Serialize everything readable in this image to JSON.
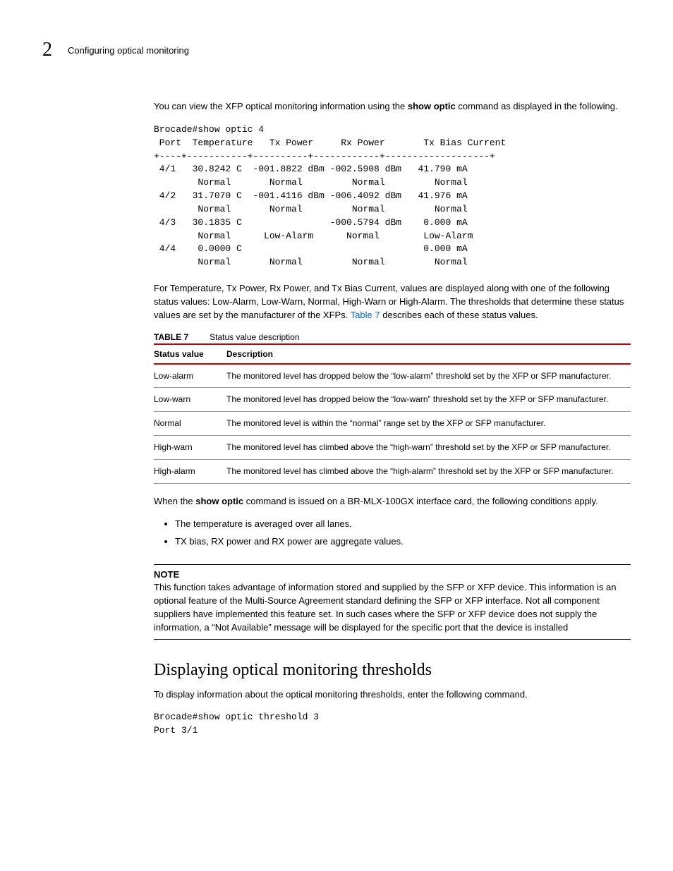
{
  "chapter": {
    "number": "2",
    "title": "Configuring optical monitoring"
  },
  "intro": {
    "p1a": "You can view the XFP optical monitoring information using the ",
    "p1cmd": "show optic",
    "p1b": " command as displayed in the following."
  },
  "codeblock1": "Brocade#show optic 4\n Port  Temperature   Tx Power     Rx Power       Tx Bias Current\n+----+-----------+----------+------------+-------------------+\n 4/1   30.8242 C  -001.8822 dBm -002.5908 dBm   41.790 mA\n        Normal       Normal         Normal         Normal\n 4/2   31.7070 C  -001.4116 dBm -006.4092 dBm   41.976 mA\n        Normal       Normal         Normal         Normal\n 4/3   30.1835 C                -000.5794 dBm    0.000 mA\n        Normal      Low-Alarm      Normal        Low-Alarm\n 4/4    0.0000 C                                 0.000 mA\n        Normal       Normal         Normal         Normal",
  "para2a": "For Temperature, Tx Power, Rx Power, and Tx Bias Current, values are displayed along with one of the following status values: Low-Alarm, Low-Warn, Normal, High-Warn or High-Alarm. The thresholds that determine these status values are set by the manufacturer of the XFPs. ",
  "para2ref": "Table 7",
  "para2b": " describes each of these status values.",
  "table": {
    "label": "TABLE 7",
    "caption": "Status value description",
    "head": {
      "c1": "Status value",
      "c2": "Description"
    },
    "rows": [
      {
        "c1": "Low-alarm",
        "c2": "The monitored level has dropped below the “low-alarm” threshold set by the XFP or SFP manufacturer."
      },
      {
        "c1": "Low-warn",
        "c2": "The monitored level has dropped below the “low-warn” threshold set by the XFP or SFP manufacturer."
      },
      {
        "c1": "Normal",
        "c2": "The monitored level is within the “normal” range set by the XFP or SFP manufacturer."
      },
      {
        "c1": "High-warn",
        "c2": "The monitored level has climbed above the “high-warn” threshold set by the XFP or SFP manufacturer."
      },
      {
        "c1": "High-alarm",
        "c2": "The monitored level has climbed above the “high-alarm” threshold set by the XFP or SFP manufacturer."
      }
    ]
  },
  "para3a": "When the ",
  "para3cmd": "show optic",
  "para3b": " command is issued on a BR-MLX-100GX interface card, the following conditions apply.",
  "bullets": [
    "The temperature is averaged over all lanes.",
    "TX bias, RX power and RX power are aggregate values."
  ],
  "note": {
    "label": "NOTE",
    "body": "This function takes advantage of information stored and supplied by the SFP or XFP device. This information is an optional feature of the Multi-Source Agreement standard defining the SFP or XFP interface. Not all component suppliers have implemented this feature set. In such cases where the SFP or XFP device does not supply the information, a “Not Available” message will be displayed for the specific port that the device is installed"
  },
  "section2": {
    "title": "Displaying optical monitoring thresholds",
    "intro": "To display information about the optical monitoring thresholds, enter the following command.",
    "code": "Brocade#show optic threshold 3\nPort 3/1"
  }
}
